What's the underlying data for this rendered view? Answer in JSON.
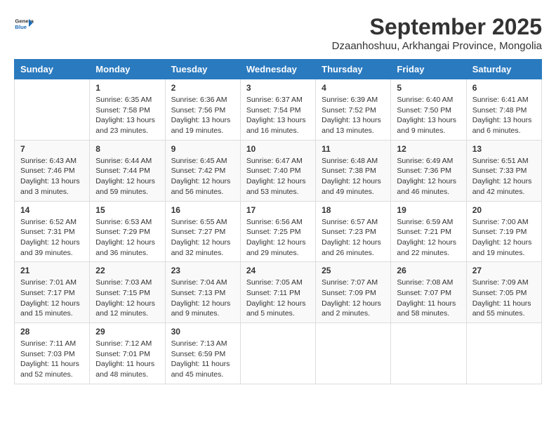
{
  "header": {
    "logo": {
      "general": "General",
      "blue": "Blue"
    },
    "title": "September 2025",
    "location": "Dzaanhoshuu, Arkhangai Province, Mongolia"
  },
  "calendar": {
    "headers": [
      "Sunday",
      "Monday",
      "Tuesday",
      "Wednesday",
      "Thursday",
      "Friday",
      "Saturday"
    ],
    "weeks": [
      [
        {
          "day": "",
          "sunrise": "",
          "sunset": "",
          "daylight": ""
        },
        {
          "day": "1",
          "sunrise": "Sunrise: 6:35 AM",
          "sunset": "Sunset: 7:58 PM",
          "daylight": "Daylight: 13 hours and 23 minutes."
        },
        {
          "day": "2",
          "sunrise": "Sunrise: 6:36 AM",
          "sunset": "Sunset: 7:56 PM",
          "daylight": "Daylight: 13 hours and 19 minutes."
        },
        {
          "day": "3",
          "sunrise": "Sunrise: 6:37 AM",
          "sunset": "Sunset: 7:54 PM",
          "daylight": "Daylight: 13 hours and 16 minutes."
        },
        {
          "day": "4",
          "sunrise": "Sunrise: 6:39 AM",
          "sunset": "Sunset: 7:52 PM",
          "daylight": "Daylight: 13 hours and 13 minutes."
        },
        {
          "day": "5",
          "sunrise": "Sunrise: 6:40 AM",
          "sunset": "Sunset: 7:50 PM",
          "daylight": "Daylight: 13 hours and 9 minutes."
        },
        {
          "day": "6",
          "sunrise": "Sunrise: 6:41 AM",
          "sunset": "Sunset: 7:48 PM",
          "daylight": "Daylight: 13 hours and 6 minutes."
        }
      ],
      [
        {
          "day": "7",
          "sunrise": "Sunrise: 6:43 AM",
          "sunset": "Sunset: 7:46 PM",
          "daylight": "Daylight: 13 hours and 3 minutes."
        },
        {
          "day": "8",
          "sunrise": "Sunrise: 6:44 AM",
          "sunset": "Sunset: 7:44 PM",
          "daylight": "Daylight: 12 hours and 59 minutes."
        },
        {
          "day": "9",
          "sunrise": "Sunrise: 6:45 AM",
          "sunset": "Sunset: 7:42 PM",
          "daylight": "Daylight: 12 hours and 56 minutes."
        },
        {
          "day": "10",
          "sunrise": "Sunrise: 6:47 AM",
          "sunset": "Sunset: 7:40 PM",
          "daylight": "Daylight: 12 hours and 53 minutes."
        },
        {
          "day": "11",
          "sunrise": "Sunrise: 6:48 AM",
          "sunset": "Sunset: 7:38 PM",
          "daylight": "Daylight: 12 hours and 49 minutes."
        },
        {
          "day": "12",
          "sunrise": "Sunrise: 6:49 AM",
          "sunset": "Sunset: 7:36 PM",
          "daylight": "Daylight: 12 hours and 46 minutes."
        },
        {
          "day": "13",
          "sunrise": "Sunrise: 6:51 AM",
          "sunset": "Sunset: 7:33 PM",
          "daylight": "Daylight: 12 hours and 42 minutes."
        }
      ],
      [
        {
          "day": "14",
          "sunrise": "Sunrise: 6:52 AM",
          "sunset": "Sunset: 7:31 PM",
          "daylight": "Daylight: 12 hours and 39 minutes."
        },
        {
          "day": "15",
          "sunrise": "Sunrise: 6:53 AM",
          "sunset": "Sunset: 7:29 PM",
          "daylight": "Daylight: 12 hours and 36 minutes."
        },
        {
          "day": "16",
          "sunrise": "Sunrise: 6:55 AM",
          "sunset": "Sunset: 7:27 PM",
          "daylight": "Daylight: 12 hours and 32 minutes."
        },
        {
          "day": "17",
          "sunrise": "Sunrise: 6:56 AM",
          "sunset": "Sunset: 7:25 PM",
          "daylight": "Daylight: 12 hours and 29 minutes."
        },
        {
          "day": "18",
          "sunrise": "Sunrise: 6:57 AM",
          "sunset": "Sunset: 7:23 PM",
          "daylight": "Daylight: 12 hours and 26 minutes."
        },
        {
          "day": "19",
          "sunrise": "Sunrise: 6:59 AM",
          "sunset": "Sunset: 7:21 PM",
          "daylight": "Daylight: 12 hours and 22 minutes."
        },
        {
          "day": "20",
          "sunrise": "Sunrise: 7:00 AM",
          "sunset": "Sunset: 7:19 PM",
          "daylight": "Daylight: 12 hours and 19 minutes."
        }
      ],
      [
        {
          "day": "21",
          "sunrise": "Sunrise: 7:01 AM",
          "sunset": "Sunset: 7:17 PM",
          "daylight": "Daylight: 12 hours and 15 minutes."
        },
        {
          "day": "22",
          "sunrise": "Sunrise: 7:03 AM",
          "sunset": "Sunset: 7:15 PM",
          "daylight": "Daylight: 12 hours and 12 minutes."
        },
        {
          "day": "23",
          "sunrise": "Sunrise: 7:04 AM",
          "sunset": "Sunset: 7:13 PM",
          "daylight": "Daylight: 12 hours and 9 minutes."
        },
        {
          "day": "24",
          "sunrise": "Sunrise: 7:05 AM",
          "sunset": "Sunset: 7:11 PM",
          "daylight": "Daylight: 12 hours and 5 minutes."
        },
        {
          "day": "25",
          "sunrise": "Sunrise: 7:07 AM",
          "sunset": "Sunset: 7:09 PM",
          "daylight": "Daylight: 12 hours and 2 minutes."
        },
        {
          "day": "26",
          "sunrise": "Sunrise: 7:08 AM",
          "sunset": "Sunset: 7:07 PM",
          "daylight": "Daylight: 11 hours and 58 minutes."
        },
        {
          "day": "27",
          "sunrise": "Sunrise: 7:09 AM",
          "sunset": "Sunset: 7:05 PM",
          "daylight": "Daylight: 11 hours and 55 minutes."
        }
      ],
      [
        {
          "day": "28",
          "sunrise": "Sunrise: 7:11 AM",
          "sunset": "Sunset: 7:03 PM",
          "daylight": "Daylight: 11 hours and 52 minutes."
        },
        {
          "day": "29",
          "sunrise": "Sunrise: 7:12 AM",
          "sunset": "Sunset: 7:01 PM",
          "daylight": "Daylight: 11 hours and 48 minutes."
        },
        {
          "day": "30",
          "sunrise": "Sunrise: 7:13 AM",
          "sunset": "Sunset: 6:59 PM",
          "daylight": "Daylight: 11 hours and 45 minutes."
        },
        {
          "day": "",
          "sunrise": "",
          "sunset": "",
          "daylight": ""
        },
        {
          "day": "",
          "sunrise": "",
          "sunset": "",
          "daylight": ""
        },
        {
          "day": "",
          "sunrise": "",
          "sunset": "",
          "daylight": ""
        },
        {
          "day": "",
          "sunrise": "",
          "sunset": "",
          "daylight": ""
        }
      ]
    ]
  }
}
